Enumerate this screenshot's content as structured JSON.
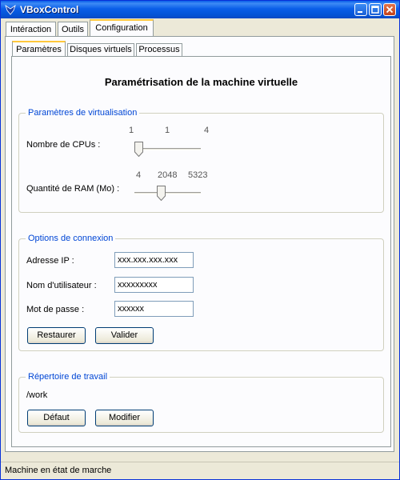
{
  "window": {
    "title": "VBoxControl"
  },
  "main_tabs": [
    {
      "label": "Intéraction"
    },
    {
      "label": "Outils"
    },
    {
      "label": "Configuration"
    }
  ],
  "sub_tabs": [
    {
      "label": "Paramètres"
    },
    {
      "label": "Disques virtuels"
    },
    {
      "label": "Processus"
    }
  ],
  "heading": "Paramétrisation de la machine virtuelle",
  "virtualisation": {
    "legend": "Paramètres de virtualisation",
    "cpu": {
      "label": "Nombre de CPUs :",
      "min": "1",
      "value": "1",
      "max": "4",
      "level": 0.0
    },
    "ram": {
      "label": "Quantité de RAM (Mo) :",
      "min": "4",
      "value": "2048",
      "max": "5323",
      "level": 0.385
    }
  },
  "connexion": {
    "legend": "Options de connexion",
    "ip": {
      "label": "Adresse IP :",
      "value": "xxx.xxx.xxx.xxx"
    },
    "user": {
      "label": "Nom d'utilisateur :",
      "value": "xxxxxxxxx"
    },
    "password": {
      "label": "Mot de passe :",
      "value": "xxxxxx"
    },
    "restore_label": "Restaurer",
    "validate_label": "Valider"
  },
  "workdir": {
    "legend": "Répertoire de travail",
    "path": "/work",
    "default_label": "Défaut",
    "modify_label": "Modifier"
  },
  "status": "Machine en état de marche",
  "colors": {
    "titlebar": "#0a5ee8",
    "accent_tab": "#ffc83c",
    "legend_text": "#0046d5",
    "window_bg": "#ece9d8"
  }
}
